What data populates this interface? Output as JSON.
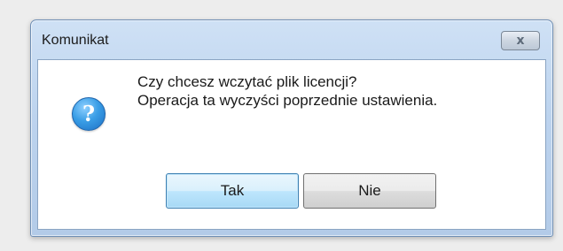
{
  "dialog": {
    "title": "Komunikat",
    "close_label": "x",
    "icon": "question-icon",
    "icon_glyph": "?",
    "message_lines": [
      "Czy chcesz wczytać plik licencji?",
      "Operacja ta wyczyści poprzednie ustawienia."
    ],
    "buttons": {
      "yes_label": "Tak",
      "no_label": "Nie"
    }
  },
  "colors": {
    "title_bar": "#bcd3ee",
    "icon_blue": "#3a9ee6",
    "default_button": "#bee6fd"
  }
}
